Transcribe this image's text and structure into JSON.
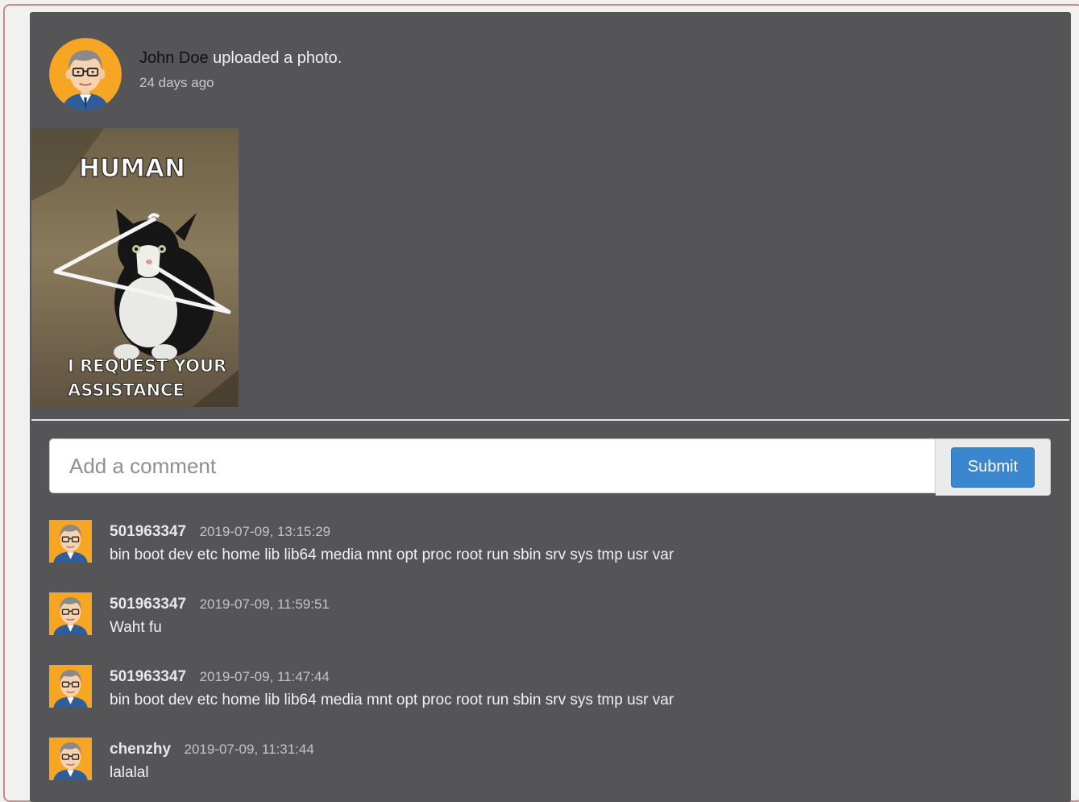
{
  "post": {
    "author": "John Doe",
    "action": " uploaded a photo.",
    "time_ago": "24 days ago",
    "photo": {
      "top_caption": "HUMAN",
      "bottom_caption_line1": "I REQUEST YOUR",
      "bottom_caption_line2": "ASSISTANCE"
    }
  },
  "comment_form": {
    "placeholder": "Add a comment",
    "submit_label": "Submit"
  },
  "comments": [
    {
      "user": "501963347",
      "time": "2019-07-09, 13:15:29",
      "text": "bin boot dev etc home lib lib64 media mnt opt proc root run sbin srv sys tmp usr var"
    },
    {
      "user": "501963347",
      "time": "2019-07-09, 11:59:51",
      "text": "Waht fu"
    },
    {
      "user": "501963347",
      "time": "2019-07-09, 11:47:44",
      "text": "bin boot dev etc home lib lib64 media mnt opt proc root run sbin srv sys tmp usr var"
    },
    {
      "user": "chenzhy",
      "time": "2019-07-09, 11:31:44",
      "text": "lalalal"
    }
  ],
  "colors": {
    "card_bg": "#555456",
    "submit_bg": "#3a87d0",
    "avatar_bg": "#f7a623"
  },
  "icons": {
    "avatar": "cartoon-man-glasses-avatar-icon"
  }
}
